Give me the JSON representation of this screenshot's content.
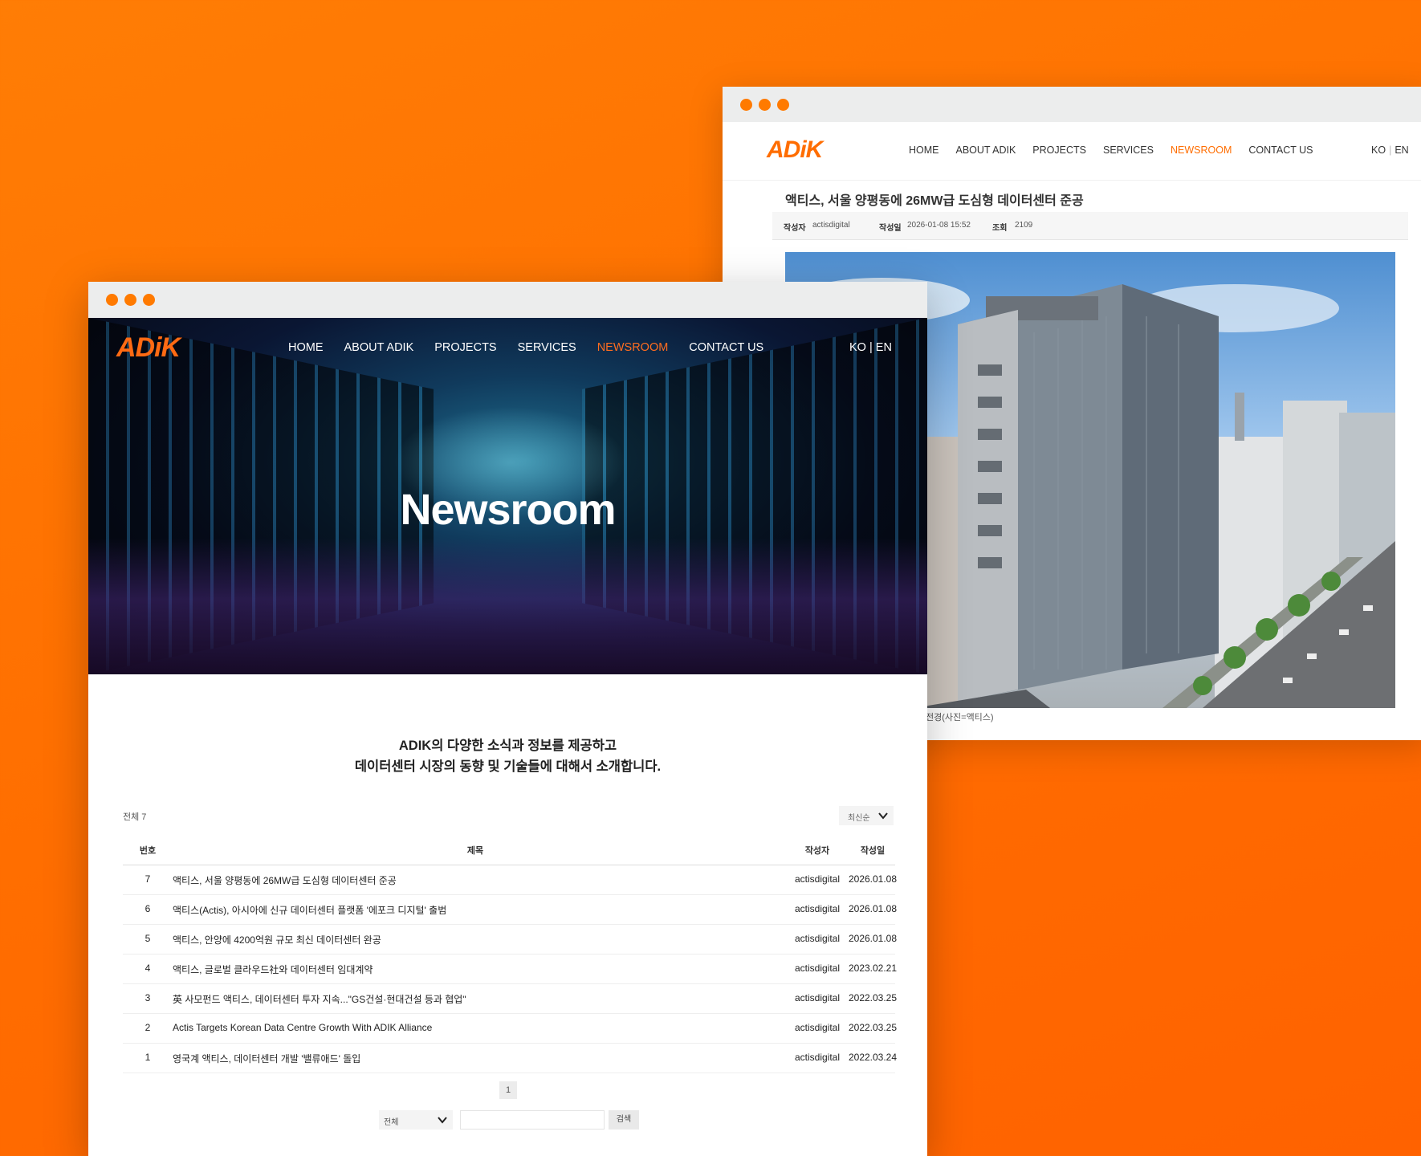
{
  "colors": {
    "accent": "#ff6d00",
    "background": "#ff7200"
  },
  "article_window": {
    "logo": "ADiK",
    "nav": {
      "items": [
        "HOME",
        "ABOUT ADIK",
        "PROJECTS",
        "SERVICES",
        "NEWSROOM",
        "CONTACT US"
      ],
      "active": "NEWSROOM"
    },
    "lang": {
      "ko": "KO",
      "en": "EN"
    },
    "article": {
      "title": "액티스, 서울 양평동에 26MW급 도심형 데이터센터 준공",
      "author_label": "작성자",
      "author": "actisdigital",
      "date_label": "작성일",
      "date": "2026-01-08 15:52",
      "views_label": "조회",
      "views": "2109",
      "caption": "전경(사진=액티스)"
    }
  },
  "list_window": {
    "logo": "ADiK",
    "nav": {
      "items": [
        "HOME",
        "ABOUT ADIK",
        "PROJECTS",
        "SERVICES",
        "NEWSROOM",
        "CONTACT US"
      ],
      "active": "NEWSROOM"
    },
    "lang": "KO | EN",
    "hero_title": "Newsroom",
    "intro": {
      "line1": "ADIK의 다양한 소식과 정보를 제공하고",
      "line2": "데이터센터 시장의 동향 및 기술들에 대해서 소개합니다."
    },
    "total": "전체 7",
    "sort": "최신순",
    "table": {
      "headers": {
        "num": "번호",
        "title": "제목",
        "author": "작성자",
        "date": "작성일"
      },
      "rows": [
        {
          "num": "7",
          "title": "액티스, 서울 양평동에 26MW급 도심형 데이터센터 준공",
          "author": "actisdigital",
          "date": "2026.01.08"
        },
        {
          "num": "6",
          "title": "액티스(Actis), 아시아에 신규 데이터센터 플랫폼 '에포크 디지털' 출범",
          "author": "actisdigital",
          "date": "2026.01.08"
        },
        {
          "num": "5",
          "title": "액티스, 안양에 4200억원 규모 최신 데이터센터 완공",
          "author": "actisdigital",
          "date": "2026.01.08"
        },
        {
          "num": "4",
          "title": "액티스, 글로벌 클라우드社와 데이터센터 임대계약",
          "author": "actisdigital",
          "date": "2023.02.21"
        },
        {
          "num": "3",
          "title": "英 사모펀드 액티스, 데이터센터 투자 지속...\"GS건설·현대건설 등과 협업\"",
          "author": "actisdigital",
          "date": "2022.03.25"
        },
        {
          "num": "2",
          "title": "Actis Targets Korean Data Centre Growth With ADIK Alliance",
          "author": "actisdigital",
          "date": "2022.03.25"
        },
        {
          "num": "1",
          "title": "영국계 액티스, 데이터센터 개발 '밸류애드' 돌입",
          "author": "actisdigital",
          "date": "2022.03.24"
        }
      ]
    },
    "pagination": {
      "current": "1"
    },
    "search": {
      "scope": "전체",
      "button": "검색",
      "value": ""
    }
  }
}
